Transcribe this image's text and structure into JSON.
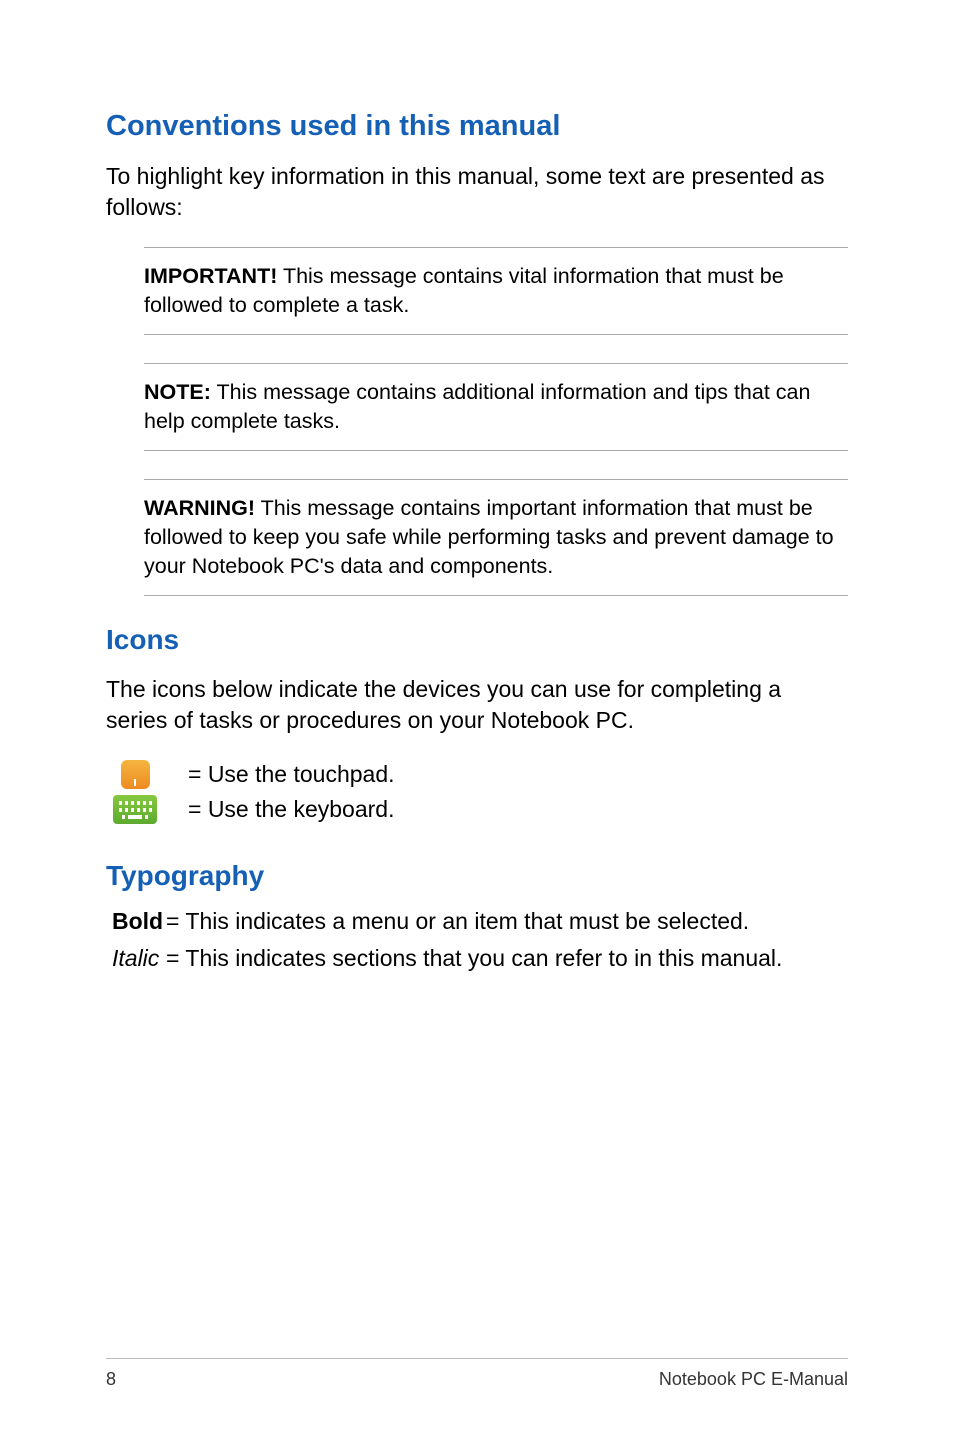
{
  "headings": {
    "conventions": "Conventions used in this manual",
    "icons": "Icons",
    "typography": "Typography"
  },
  "body": {
    "conventions_intro": "To highlight key information in this manual, some text are presented as follows:",
    "icons_intro": "The icons below indicate the devices you can use for completing a series of tasks or procedures on your Notebook PC."
  },
  "notes": {
    "important": {
      "label": "IMPORTANT!",
      "text": " This message contains vital information that must be followed to complete a task."
    },
    "note": {
      "label": "NOTE:",
      "text": " This message contains additional information and tips that can help complete tasks."
    },
    "warning": {
      "label": "WARNING!",
      "text": " This message contains important information that must be followed to keep you safe while performing tasks and prevent damage to your Notebook PC's data and components."
    }
  },
  "icons": {
    "touchpad": "= Use the touchpad.",
    "keyboard": "= Use the keyboard."
  },
  "typography": {
    "bold_label": "Bold",
    "bold_text": "= This indicates a menu or an item that must be selected.",
    "italic_label": "Italic",
    "italic_text": "= This indicates sections that you can refer to in this manual."
  },
  "footer": {
    "page": "8",
    "title": "Notebook PC E-Manual"
  }
}
